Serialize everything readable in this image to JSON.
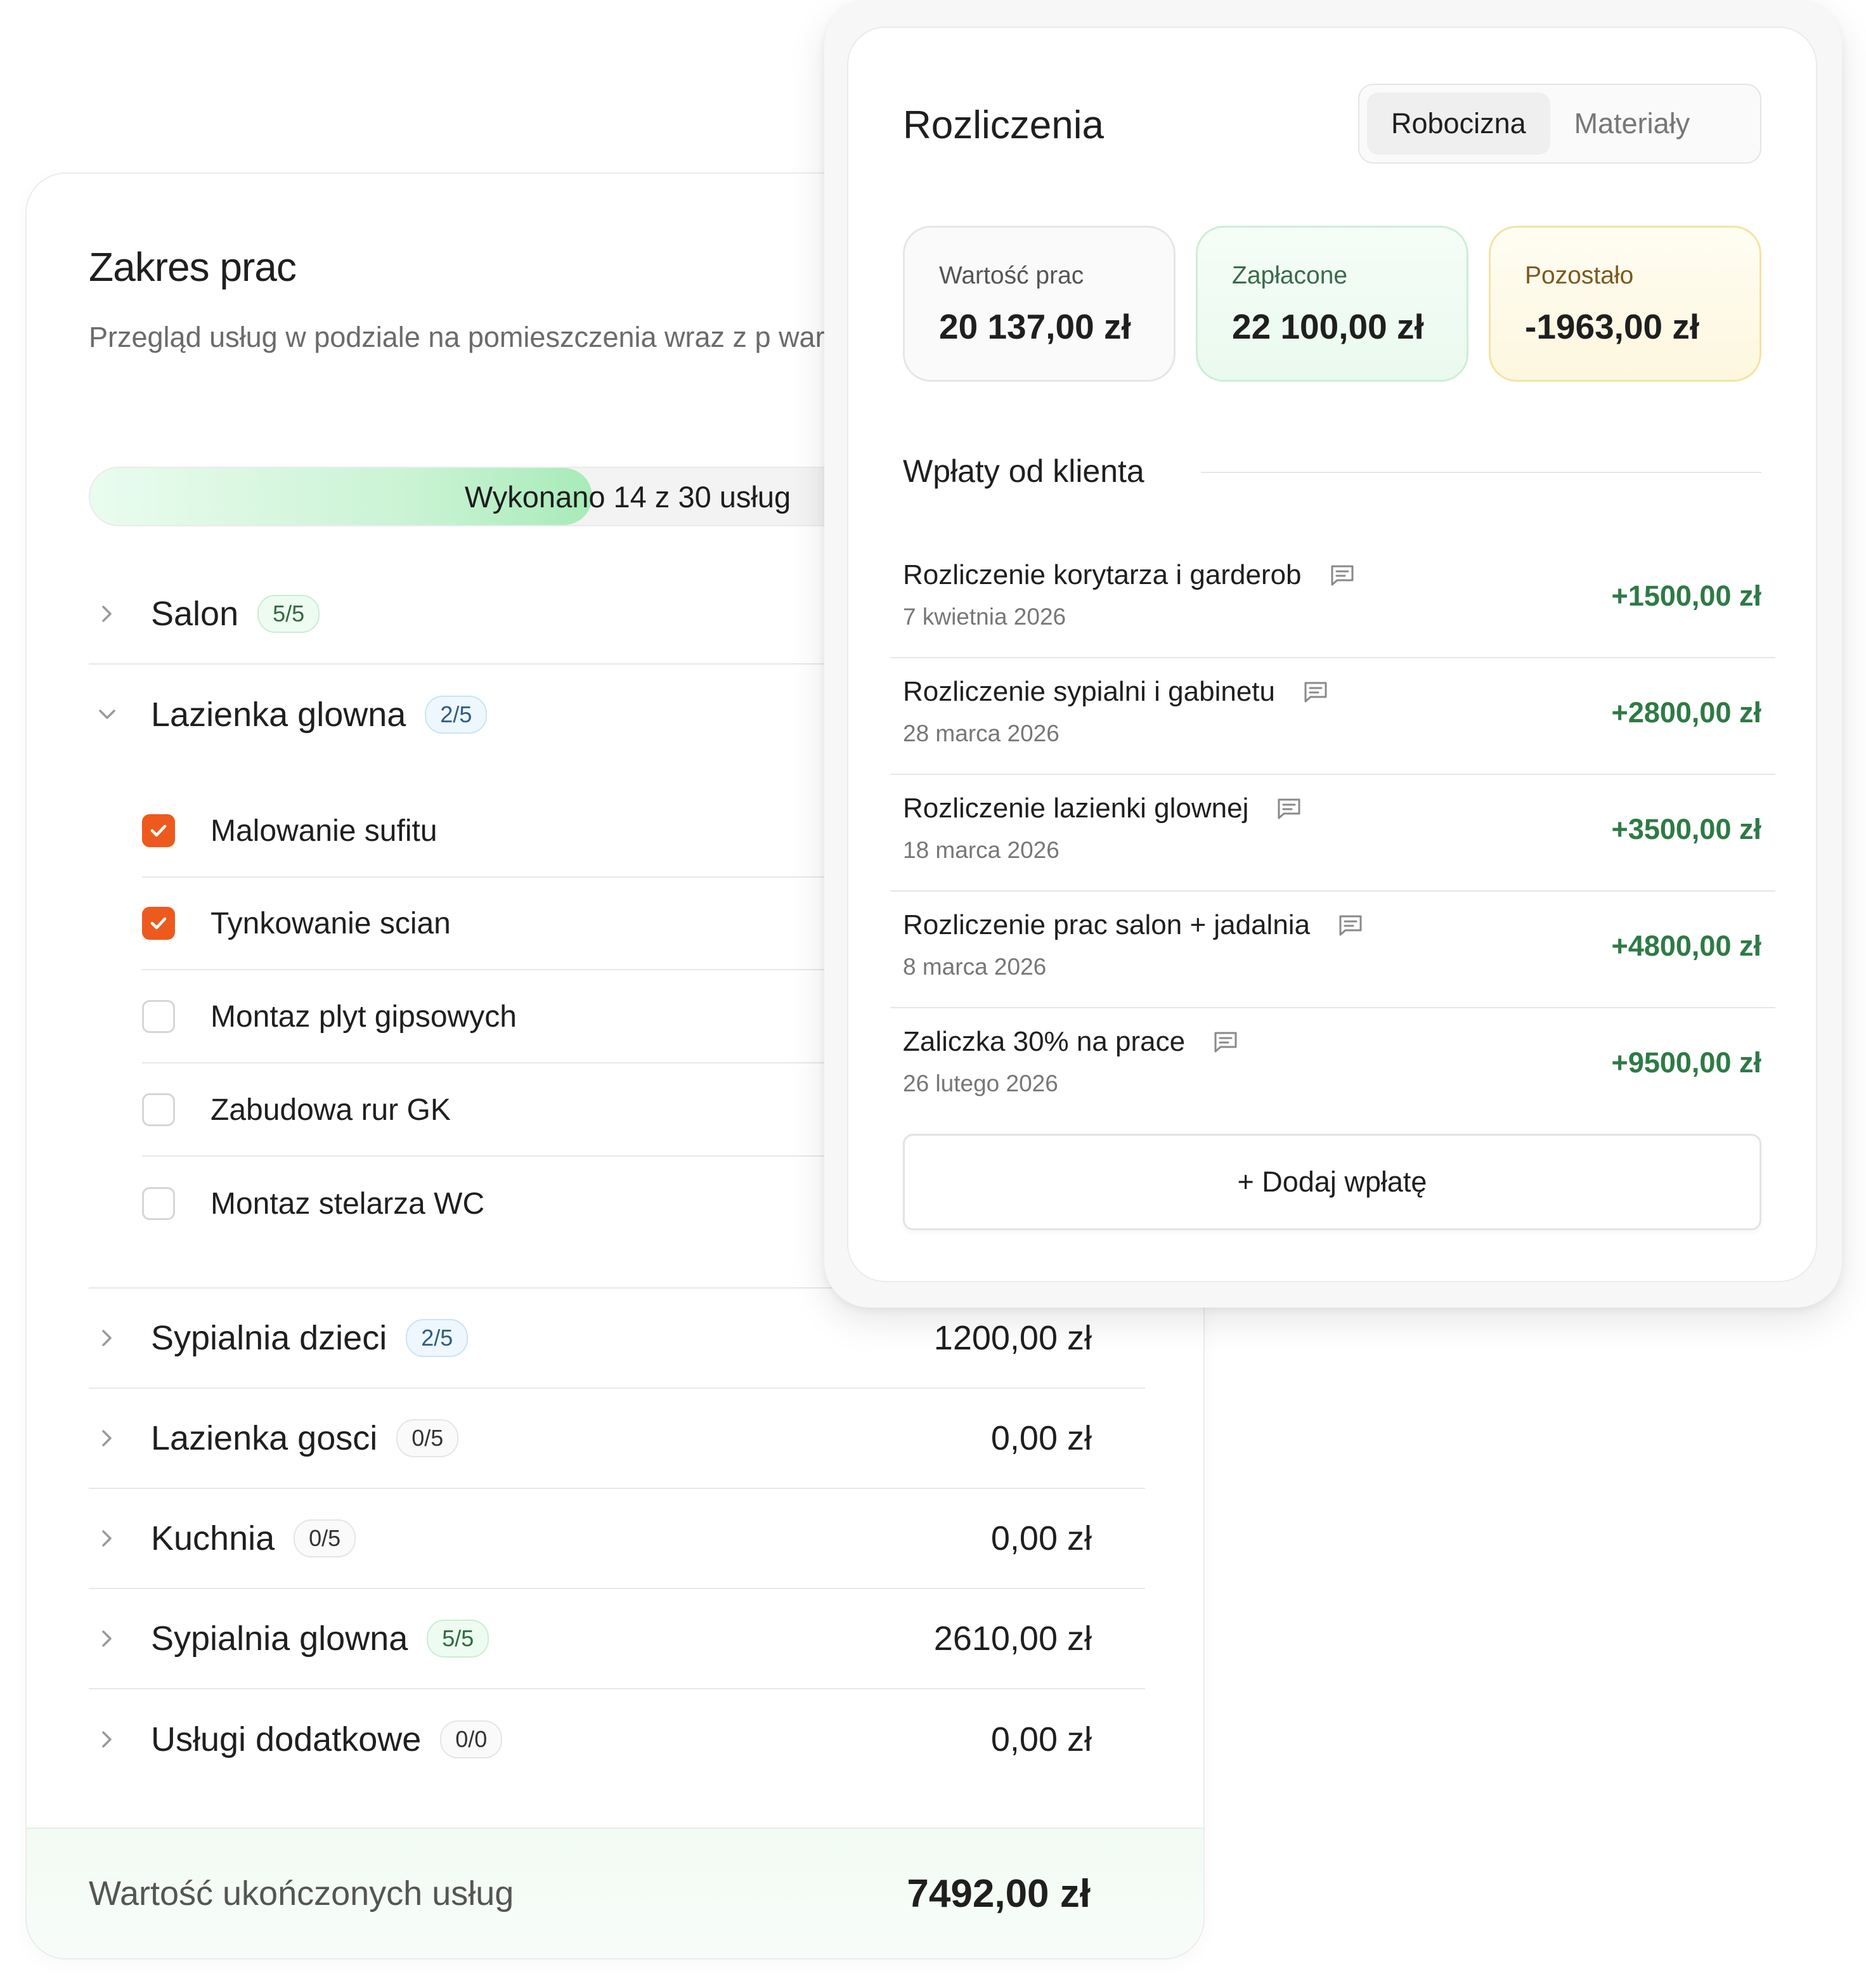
{
  "scope": {
    "title": "Zakres prac",
    "subtitle": "Przegląd usług w podziale na pomieszczenia wraz z p wartościami.",
    "progress_label": "Wykonano 14 z 30 usług",
    "progress_fraction": 0.4667,
    "rooms": [
      {
        "name": "Salon",
        "badge": "5/5",
        "amount": "",
        "expanded": false
      },
      {
        "name": "Lazienka glowna",
        "badge": "2/5",
        "amount": "",
        "expanded": true
      },
      {
        "name": "Sypialnia dzieci",
        "badge": "2/5",
        "amount": "1200,00 zł",
        "expanded": false
      },
      {
        "name": "Lazienka gosci",
        "badge": "0/5",
        "amount": "0,00 zł",
        "expanded": false
      },
      {
        "name": "Kuchnia",
        "badge": "0/5",
        "amount": "0,00 zł",
        "expanded": false
      },
      {
        "name": "Sypialnia glowna",
        "badge": "5/5",
        "amount": "2610,00 zł",
        "expanded": false
      },
      {
        "name": "Usługi dodatkowe",
        "badge": "0/0",
        "amount": "0,00 zł",
        "expanded": false
      }
    ],
    "tasks": [
      {
        "label": "Malowanie sufitu",
        "checked": true
      },
      {
        "label": "Tynkowanie scian",
        "checked": true
      },
      {
        "label": "Montaz plyt gipsowych",
        "checked": false
      },
      {
        "label": "Zabudowa rur GK",
        "checked": false
      },
      {
        "label": "Montaz stelarza WC",
        "checked": false
      }
    ],
    "footer_label": "Wartość ukończonych usług",
    "footer_amount": "7492,00 zł"
  },
  "billing": {
    "title": "Rozliczenia",
    "tabs": [
      {
        "label": "Robocizna",
        "active": true
      },
      {
        "label": "Materiały",
        "active": false
      }
    ],
    "stats": [
      {
        "label": "Wartość prac",
        "value": "20 137,00 zł"
      },
      {
        "label": "Zapłacone",
        "value": "22 100,00 zł"
      },
      {
        "label": "Pozostało",
        "value": "-1963,00 zł"
      }
    ],
    "payments_heading": "Wpłaty od klienta",
    "payments": [
      {
        "title": "Rozliczenie korytarza i garderob",
        "date": "7 kwietnia 2026",
        "amount": "+1500,00 zł"
      },
      {
        "title": "Rozliczenie sypialni i gabinetu",
        "date": "28 marca 2026",
        "amount": "+2800,00 zł"
      },
      {
        "title": "Rozliczenie lazienki glownej",
        "date": "18 marca 2026",
        "amount": "+3500,00 zł"
      },
      {
        "title": "Rozliczenie prac salon + jadalnia",
        "date": "8 marca 2026",
        "amount": "+4800,00 zł"
      },
      {
        "title": "Zaliczka 30% na prace",
        "date": "26 lutego 2026",
        "amount": "+9500,00 zł"
      }
    ],
    "add_button": "+ Dodaj wpłatę"
  },
  "colors": {
    "accent_orange": "#ee5a1d",
    "positive_green": "#2e7a45",
    "progress_green": "#a8ebb8"
  },
  "icons": {
    "collapsed": "chevron-right-icon",
    "expanded": "chevron-down-icon",
    "checkbox_checked": "check-icon",
    "payment_note": "note-icon"
  }
}
